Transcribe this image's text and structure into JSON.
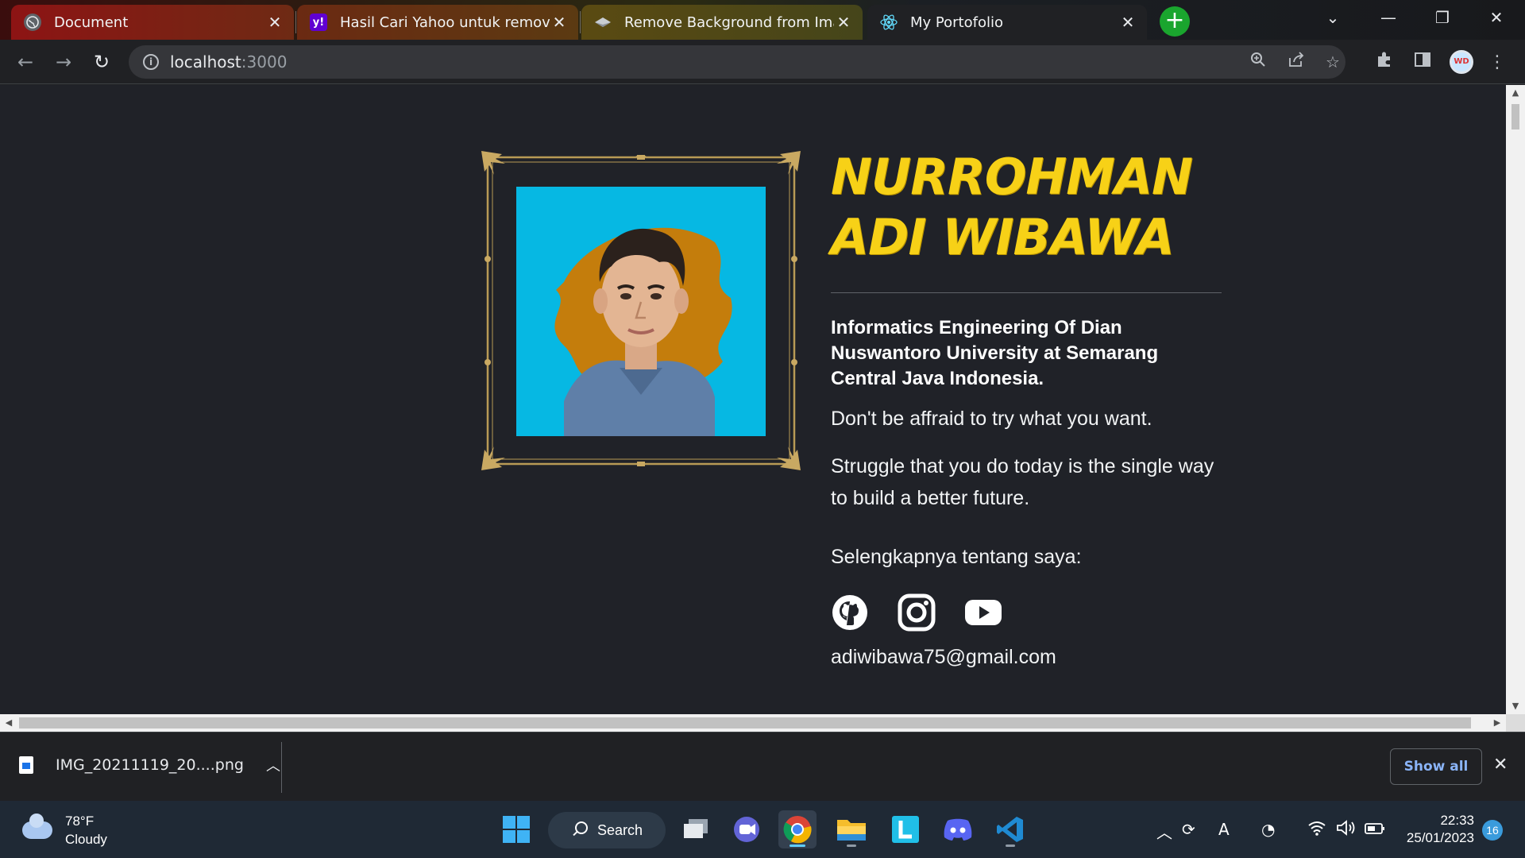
{
  "browser": {
    "tabs": [
      {
        "title": "Document",
        "icon": "globe-icon"
      },
      {
        "title": "Hasil Cari Yahoo untuk remove bg",
        "icon": "yahoo-icon"
      },
      {
        "title": "Remove Background from Image",
        "icon": "removebg-icon"
      },
      {
        "title": "My Portofolio",
        "icon": "react-icon",
        "active": true
      }
    ],
    "address": {
      "host": "localhost",
      "port": ":3000"
    },
    "profile_initials": "WD"
  },
  "page": {
    "name_line1": "NURROHMAN",
    "name_line2": "ADI WIBAWA",
    "subtitle": "Informatics Engineering Of Dian Nuswantoro University at Semarang Central Java Indonesia.",
    "motto": "Don't be affraid to try what you want.",
    "quote": "Struggle that you do today is the single way to build a better future.",
    "more_label": "Selengkapnya tentang saya:",
    "social": [
      "github-icon",
      "instagram-icon",
      "youtube-icon"
    ],
    "email": "adiwibawa75@gmail.com",
    "accent_color": "#f7d117",
    "portrait_bg": "#06b8e3"
  },
  "downloads": {
    "file_name": "IMG_20211119_20....png",
    "show_all": "Show all"
  },
  "taskbar": {
    "temperature": "78°F",
    "condition": "Cloudy",
    "search_label": "Search",
    "time": "22:33",
    "date": "25/01/2023",
    "notification_count": "16"
  }
}
